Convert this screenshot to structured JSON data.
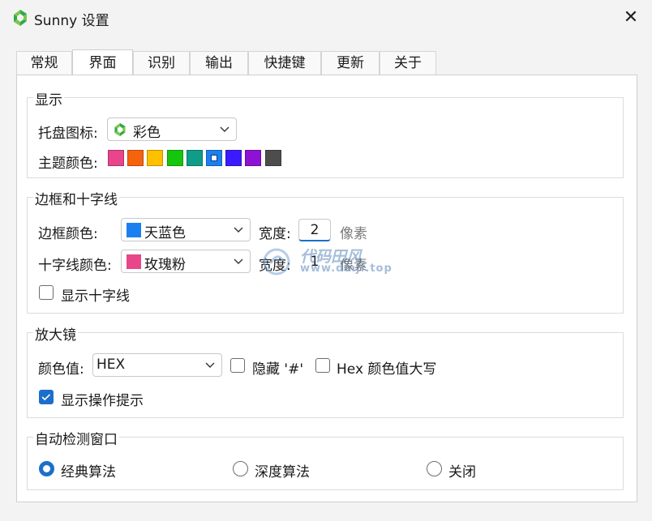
{
  "window": {
    "title": "Sunny 设置",
    "app_icon": "sunny-logo-icon",
    "close_glyph": "✕"
  },
  "tabs": [
    {
      "label": "常规"
    },
    {
      "label": "界面"
    },
    {
      "label": "识别"
    },
    {
      "label": "输出"
    },
    {
      "label": "快捷键"
    },
    {
      "label": "更新"
    },
    {
      "label": "关于"
    }
  ],
  "active_tab": "界面",
  "display": {
    "title": "显示",
    "tray_icon_label": "托盘图标:",
    "tray_icon_value": "彩色",
    "theme_color_label": "主题颜色:",
    "theme_colors": [
      "#e8458b",
      "#f7630c",
      "#ffc000",
      "#16c60c",
      "#0f9d8a",
      "#1c7ff0",
      "#3a1bff",
      "#8e12d4",
      "#4d4d4d"
    ],
    "theme_selected_index": 5
  },
  "border": {
    "title": "边框和十字线",
    "border_color_label": "边框颜色:",
    "border_color_value": "天蓝色",
    "border_color_swatch": "#1c7ff0",
    "width_label": "宽度:",
    "border_width": "2",
    "unit": "像素",
    "cross_color_label": "十字线颜色:",
    "cross_color_value": "玫瑰粉",
    "cross_color_swatch": "#e8458b",
    "cross_width": "1",
    "show_cross_label": "显示十字线",
    "show_cross_checked": false
  },
  "magnifier": {
    "title": "放大镜",
    "color_value_label": "颜色值:",
    "color_format": "HEX",
    "hide_hash_label": "隐藏 '#'",
    "hide_hash_checked": false,
    "uppercase_label": "Hex 颜色值大写",
    "uppercase_checked": false,
    "show_tips_label": "显示操作提示",
    "show_tips_checked": true
  },
  "auto_detect": {
    "title": "自动检测窗口",
    "options": [
      "经典算法",
      "深度算法",
      "关闭"
    ],
    "selected": "经典算法"
  },
  "watermark": {
    "brand": "代码田风",
    "url": "www.dmjf.top"
  },
  "accent": "#1c6fc9"
}
